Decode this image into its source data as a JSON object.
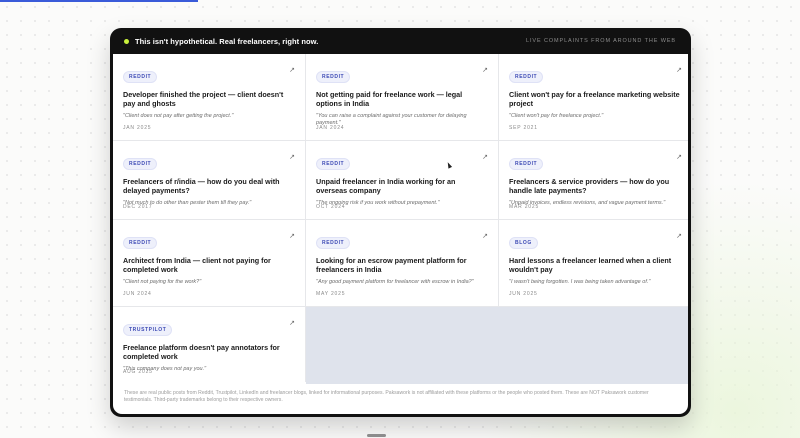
{
  "header": {
    "title": "This isn't hypothetical. Real freelancers, right now.",
    "subtitle": "LIVE COMPLAINTS FROM AROUND THE WEB",
    "live_dot_color": "#c8f03c"
  },
  "icons": {
    "open_link": "arrow-up-right-icon"
  },
  "posts": [
    {
      "source": "REDDIT",
      "title": "Developer finished the project — client doesn't pay and ghosts",
      "quote": "\"Client does not pay after getting the project.\"",
      "date": "JAN 2025",
      "arrow": "↗"
    },
    {
      "source": "REDDIT",
      "title": "Not getting paid for freelance work — legal options in India",
      "quote": "\"You can raise a complaint against your customer for delaying payment.\"",
      "date": "JAN 2024",
      "arrow": "↗"
    },
    {
      "source": "REDDIT",
      "title": "Client won't pay for a freelance marketing website project",
      "quote": "\"Client won't pay for freelance project.\"",
      "date": "SEP 2021",
      "arrow": "↗"
    },
    {
      "source": "REDDIT",
      "title": "Freelancers of r/india — how do you deal with delayed payments?",
      "quote": "\"Not much to do other than pester them till they pay.\"",
      "date": "DEC 2017",
      "arrow": "↗"
    },
    {
      "source": "REDDIT",
      "title": "Unpaid freelancer in India working for an overseas company",
      "quote": "\"The ongoing risk if you work without prepayment.\"",
      "date": "OCT 2024",
      "arrow": "↗"
    },
    {
      "source": "REDDIT",
      "title": "Freelancers & service providers — how do you handle late payments?",
      "quote": "\"Unpaid invoices, endless revisions, and vague payment terms.\"",
      "date": "MAR 2025",
      "arrow": "↗"
    },
    {
      "source": "REDDIT",
      "title": "Architect from India — client not paying for completed work",
      "quote": "\"Client not paying for the work?\"",
      "date": "JUN 2024",
      "arrow": "↗"
    },
    {
      "source": "REDDIT",
      "title": "Looking for an escrow payment platform for freelancers in India",
      "quote": "\"Any good payment platform for freelancer with escrow in India?\"",
      "date": "MAY 2025",
      "arrow": "↗"
    },
    {
      "source": "BLOG",
      "title": "Hard lessons a freelancer learned when a client wouldn't pay",
      "quote": "\"I wasn't being forgotten. I was being taken advantage of.\"",
      "date": "JUN 2025",
      "arrow": "↗"
    },
    {
      "source": "TRUSTPILOT",
      "title": "Freelance platform doesn't pay annotators for completed work",
      "quote": "\"This company does not pay you.\"",
      "date": "AUG 2025",
      "arrow": "↗"
    }
  ],
  "footer": {
    "disclaimer": "These are real public posts from Reddit, Trustpilot, LinkedIn and freelancer blogs, linked for informational purposes. Paksawork is not affiliated with these platforms or the people who posted them. These are NOT Paksawork customer testimonials. Third-party trademarks belong to their respective owners."
  }
}
